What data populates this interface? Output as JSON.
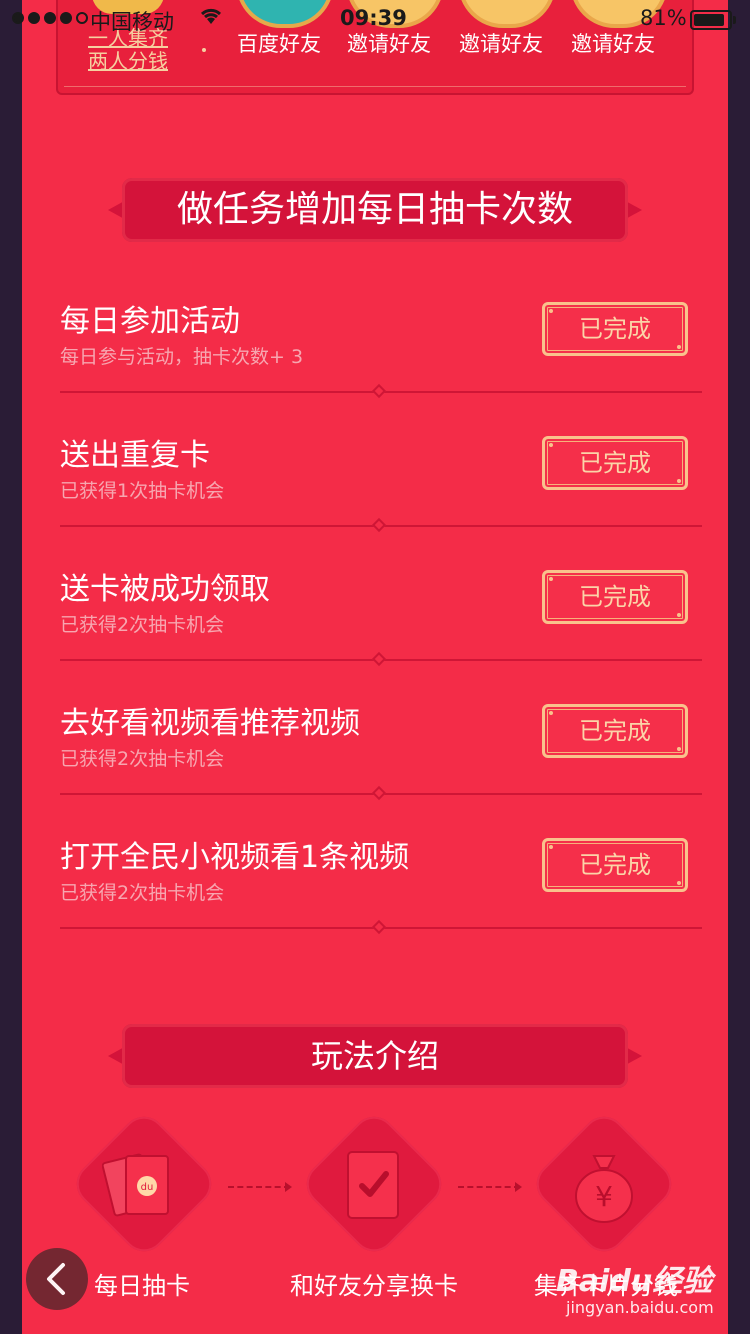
{
  "status_bar": {
    "carrier": "中国移动",
    "time": "09:39",
    "battery": "81%"
  },
  "top_panel": {
    "promo_line1": "一人集齐",
    "promo_line2": "两人分钱",
    "friends": [
      {
        "label": "百度好友"
      },
      {
        "label": "邀请好友"
      },
      {
        "label": "邀请好友"
      },
      {
        "label": "邀请好友"
      }
    ]
  },
  "tasks_section": {
    "title": "做任务增加每日抽卡次数",
    "tasks": [
      {
        "title": "每日参加活动",
        "subtitle": "每日参与活动，抽卡次数+ 3",
        "button": "已完成"
      },
      {
        "title": "送出重复卡",
        "subtitle": "已获得1次抽卡机会",
        "button": "已完成"
      },
      {
        "title": "送卡被成功领取",
        "subtitle": "已获得2次抽卡机会",
        "button": "已完成"
      },
      {
        "title": "去好看视频看推荐视频",
        "subtitle": "已获得2次抽卡机会",
        "button": "已完成"
      },
      {
        "title": "打开全民小视频看1条视频",
        "subtitle": "已获得2次抽卡机会",
        "button": "已完成"
      }
    ]
  },
  "rules_section": {
    "title": "玩法介绍",
    "steps": [
      {
        "label": "每日抽卡",
        "icon": "red-envelope-cards-icon"
      },
      {
        "label": "和好友分享换卡",
        "icon": "card-check-icon"
      },
      {
        "label": "集齐卡片分钱",
        "icon": "money-bag-icon"
      }
    ]
  },
  "watermark": {
    "brand": "Baidu经验",
    "url": "jingyan.baidu.com"
  },
  "colors": {
    "background": "#f42c48",
    "banner": "#d4133a",
    "button_border": "#f9c28c",
    "subtitle": "#f7a6b0"
  }
}
